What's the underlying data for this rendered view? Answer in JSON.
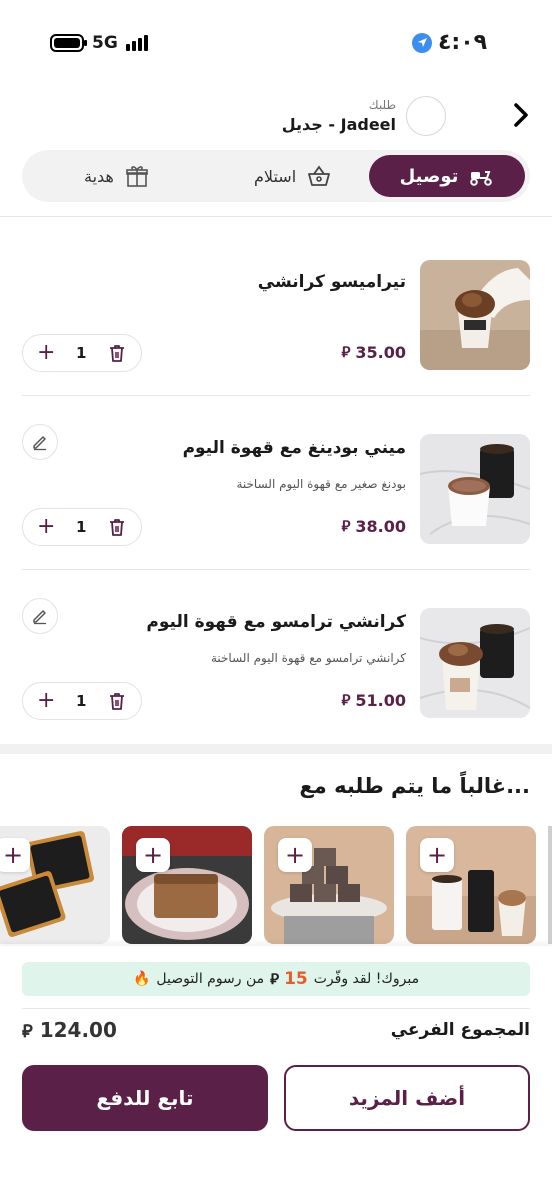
{
  "status_bar": {
    "time": "٤:٠٩",
    "network": "5G"
  },
  "store": {
    "caption": "طلبك",
    "name": "جديل - Jadeel"
  },
  "mode_tabs": [
    {
      "label": "توصيل",
      "icon": "delivery-scooter-icon",
      "active": true
    },
    {
      "label": "استلام",
      "icon": "basket-icon",
      "active": false
    },
    {
      "label": "هدية",
      "icon": "gift-icon",
      "active": false
    }
  ],
  "currency_symbol": "⃁",
  "cart_items": [
    {
      "title": "تيراميسو كرانشي",
      "description": "",
      "price": "35.00",
      "qty": "1",
      "editable": false
    },
    {
      "title": "ميني بودينغ مع قهوة اليوم",
      "description": "بودنغ صغير مع قهوة اليوم الساخنة",
      "price": "38.00",
      "qty": "1",
      "editable": true
    },
    {
      "title": "كرانشي ترامسو مع قهوة اليوم",
      "description": "كرانشي ترامسو مع قهوة اليوم الساخنة",
      "price": "51.00",
      "qty": "1",
      "editable": true
    }
  ],
  "recommendations": {
    "title": "غالباً ما يتم طلبه مع..."
  },
  "promo": {
    "before": "مبروك! لقد وفّرت",
    "amount": "15",
    "after": "من رسوم التوصيل",
    "emoji": "🔥"
  },
  "subtotal": {
    "label": "المجموع الفرعي",
    "value": "124.00"
  },
  "buttons": {
    "add_more": "أضف المزيد",
    "checkout": "تابع للدفع"
  },
  "colors": {
    "brand": "#5a2047",
    "promo_bg": "#dff5ec",
    "promo_amount": "#e85d26"
  }
}
